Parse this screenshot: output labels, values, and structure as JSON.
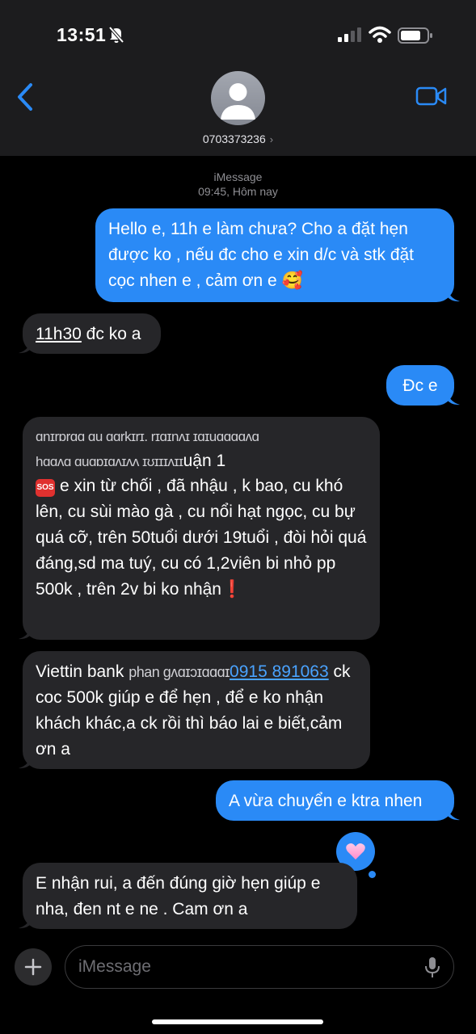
{
  "status_bar": {
    "time": "13:51"
  },
  "header": {
    "contact": "0703373236"
  },
  "thread": {
    "service": "iMessage",
    "timestamp": "09:45, Hôm nay"
  },
  "messages": {
    "m1": "Hello e, 11h e làm chưa? Cho a đặt hẹn được ko , nếu đc cho e xin d/c và stk đặt cọc nhen e , cảm ơn e 🥰",
    "m2_time": "11h30",
    "m2_rest": " đc ko a",
    "m3": "Đc e",
    "m4_line1": "ɑnɪrɒrɑɑ ɑu ɑɑrkɪrɪ. rɪɑɪnʌɪ ɪɑɪuɑɑɑɑʌɑ",
    "m4_line2_garbled": "hɑɑʌɑ ɑuɑɒɪɑʌɪʌʌ ɪʊɪɪɪʌɪɪ",
    "m4_line2_end": "uận 1",
    "m4_body": "e xin từ chối , đã nhậu , k bao, cu khó lên, cu sùi mào gà , cu nổi hạt ngọc, cu bự quá cỡ, trên 50tuổi dưới 19tuổi , đòi hỏi quá đáng,sd ma tuý, cu có 1,2viên bi nhỏ pp 500k , trên 2v bi ko nhận",
    "m4_sos": "SOS",
    "m4_excl": "❗",
    "m5_start": "Viettin bank ",
    "m5_garble": "phan gʌɑɪɔɪɑɑɑɪ",
    "m5_number": "0915 891063",
    "m5_body": "ck coc 500k giúp e để hẹn , để e ko nhận khách khác,a ck rồi thì báo lai e biết,cảm ơn a",
    "m6": "A vừa chuyển e ktra nhen",
    "m7": "E nhận rui, a đến đúng giờ hẹn giúp e nha, đen nt e ne . Cam ơn a",
    "tapback": "heart"
  },
  "composer": {
    "placeholder": "iMessage"
  },
  "colors": {
    "outgoing": "#2a8af6",
    "incoming": "#262629",
    "background": "#000000",
    "bar": "#1c1c1e"
  }
}
